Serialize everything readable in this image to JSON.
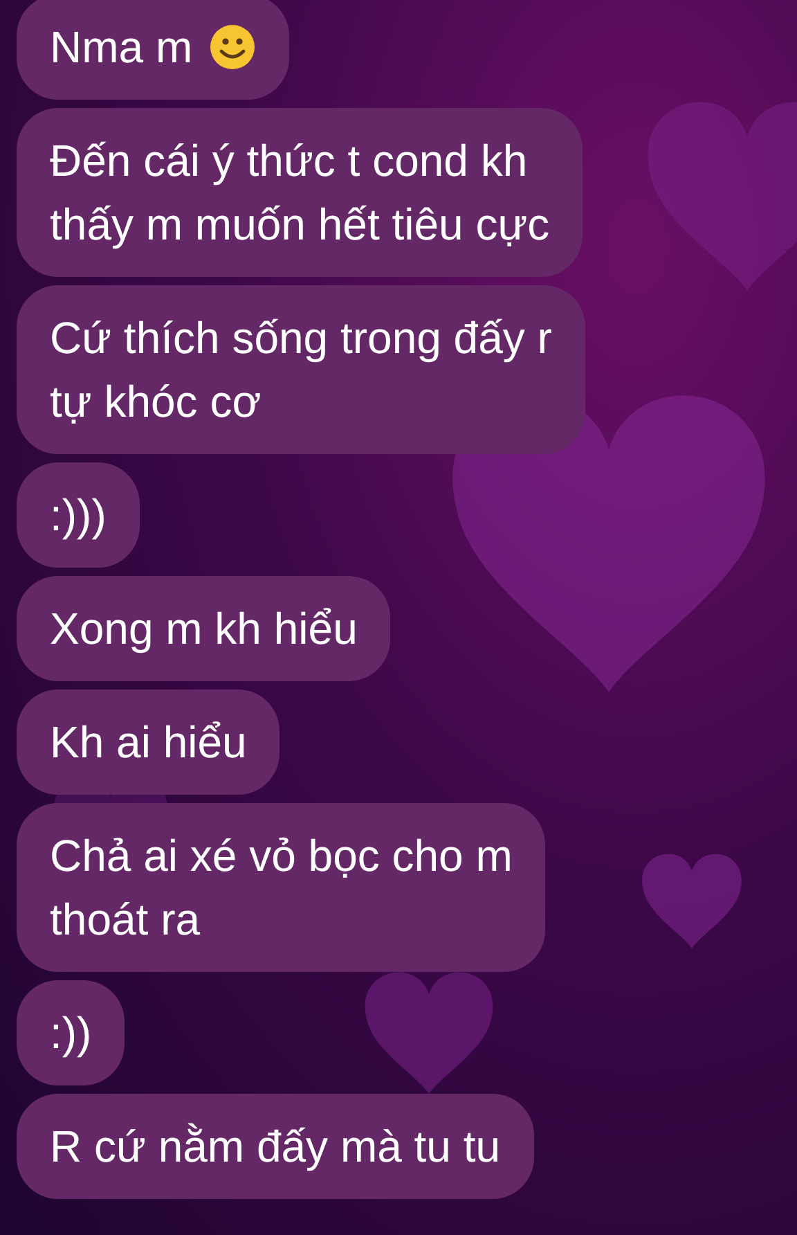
{
  "messages": [
    {
      "text": "Nma m",
      "emoji": true
    },
    {
      "text": "Đến cái ý thức t cond kh\nthấy m muốn hết tiêu cực",
      "emoji": false
    },
    {
      "text": "Cứ thích sống trong đấy r\ntự khóc cơ",
      "emoji": false
    },
    {
      "text": ":)))",
      "emoji": false
    },
    {
      "text": "Xong m kh hiểu",
      "emoji": false
    },
    {
      "text": "Kh ai hiểu",
      "emoji": false
    },
    {
      "text": "Chả ai xé vỏ bọc cho m\nthoát ra",
      "emoji": false
    },
    {
      "text": ":))",
      "emoji": false
    },
    {
      "text": "R cứ nằm đấy mà tu tu",
      "emoji": false
    }
  ]
}
